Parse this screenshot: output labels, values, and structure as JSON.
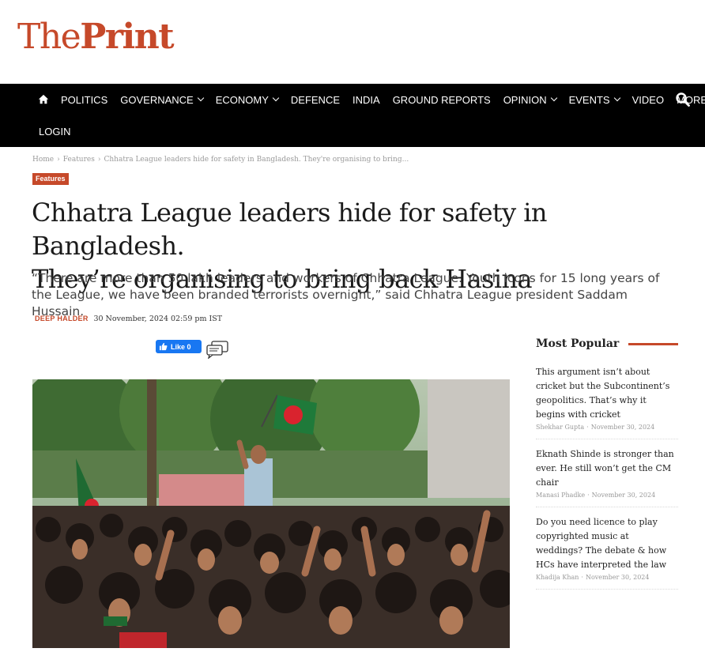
{
  "logo": {
    "the": "The",
    "print": "Print"
  },
  "nav": {
    "row1": [
      {
        "label": "POLITICS",
        "dropdown": false
      },
      {
        "label": "GOVERNANCE",
        "dropdown": true
      },
      {
        "label": "ECONOMY",
        "dropdown": true
      },
      {
        "label": "DEFENCE",
        "dropdown": false
      },
      {
        "label": "INDIA",
        "dropdown": false
      },
      {
        "label": "GROUND REPORTS",
        "dropdown": false
      },
      {
        "label": "OPINION",
        "dropdown": true
      },
      {
        "label": "EVENTS",
        "dropdown": true
      },
      {
        "label": "VIDEO",
        "dropdown": false
      },
      {
        "label": "MORE",
        "dropdown": true
      }
    ],
    "login": "LOGIN",
    "icons": {
      "home": "home-icon",
      "search": "search-icon"
    }
  },
  "breadcrumb": {
    "home": "Home",
    "section": "Features",
    "current": "Chhatra League leaders hide for safety in Bangladesh. They're organising to bring..."
  },
  "article": {
    "category": "Features",
    "headline_line1": "Chhatra League leaders hide for safety in Bangladesh.",
    "headline_line2": "They’re organising to bring back Hasina",
    "subhead": "“There are more than 50 lakh leaders and workers of Chhatra League. Youth icons for 15 long years of the League, we have been branded terrorists overnight,” said Chhatra League president Saddam Hussain.",
    "author": "DEEP HALDER",
    "date": "30 November, 2024 02:59 pm IST",
    "fb_like": "Like 0"
  },
  "sidebar": {
    "title": "Most Popular",
    "items": [
      {
        "title": "This argument isn’t about cricket but the Subcontinent’s geopolitics. That’s why it begins with cricket",
        "author": "Shekhar Gupta",
        "date": "November 30, 2024"
      },
      {
        "title": "Eknath Shinde is stronger than ever. He still won’t get the CM chair",
        "author": "Manasi Phadke",
        "date": "November 30, 2024"
      },
      {
        "title": "Do you need licence to play copyrighted music at weddings? The debate & how HCs have interpreted the law",
        "author": "Khadija Khan",
        "date": "November 30, 2024"
      }
    ]
  },
  "colors": {
    "brand": "#c6492a",
    "nav_bg": "#000000",
    "facebook": "#1877f2"
  }
}
